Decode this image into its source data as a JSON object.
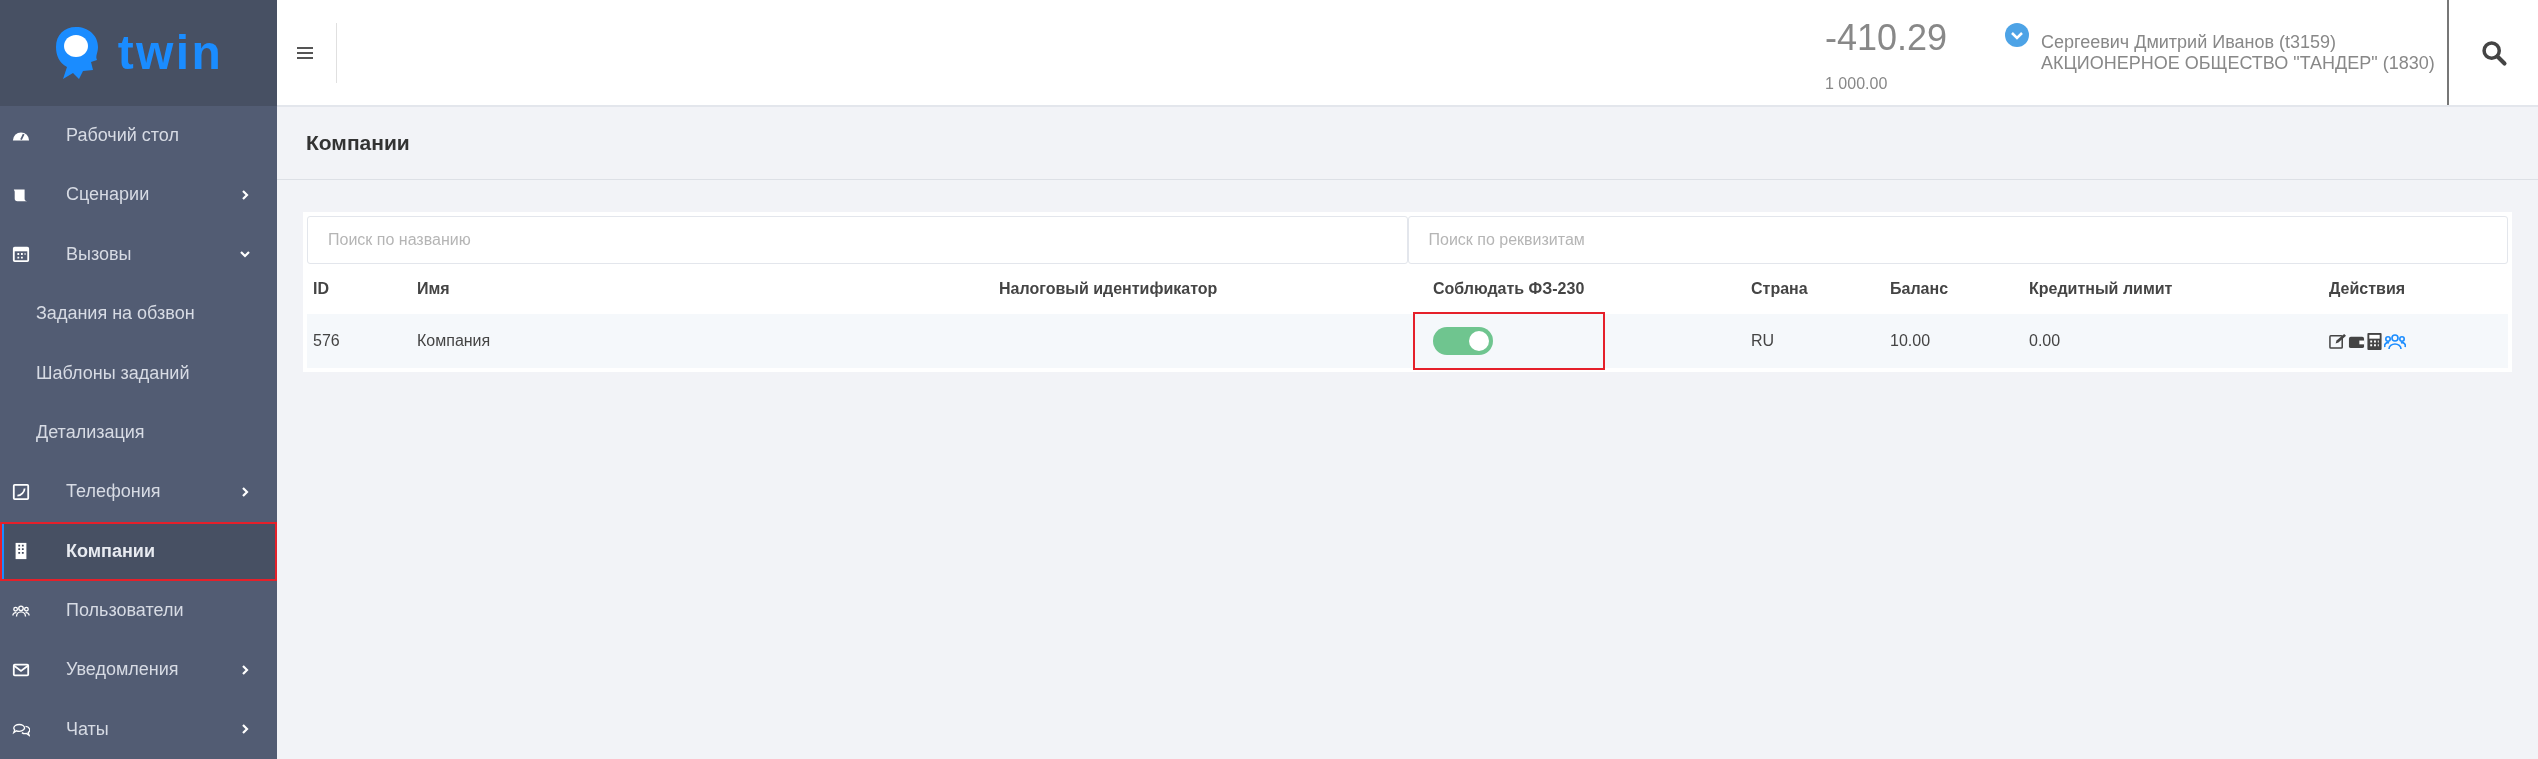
{
  "logo": {
    "text": "twin"
  },
  "topbar": {
    "balance": "-410.29",
    "credit": "1 000.00",
    "user": "Сергеевич Дмитрий Иванов (t3159)",
    "company": "АКЦИОНЕРНОЕ ОБЩЕСТВО \"ТАНДЕР\" (1830)"
  },
  "sidebar": {
    "items": [
      {
        "kind": "item",
        "label": "Рабочий стол",
        "selected": false,
        "highlighted": false
      },
      {
        "kind": "item",
        "label": "Сценарии",
        "selected": false,
        "highlighted": false,
        "expanded": false
      },
      {
        "kind": "item",
        "label": "Вызовы",
        "selected": false,
        "highlighted": false,
        "expanded": true
      },
      {
        "kind": "subitem",
        "label": "Задания на обзвон",
        "selected": false,
        "highlighted": false
      },
      {
        "kind": "subitem",
        "label": "Шаблоны заданий",
        "selected": false,
        "highlighted": false
      },
      {
        "kind": "subitem",
        "label": "Детализация",
        "selected": false,
        "highlighted": false
      },
      {
        "kind": "item",
        "label": "Телефония",
        "selected": false,
        "highlighted": false,
        "expanded": false
      },
      {
        "kind": "item",
        "label": "Компании",
        "selected": true,
        "highlighted": true
      },
      {
        "kind": "item",
        "label": "Пользователи",
        "selected": false,
        "highlighted": false
      },
      {
        "kind": "item",
        "label": "Уведомления",
        "selected": false,
        "highlighted": false,
        "expanded": false
      },
      {
        "kind": "item",
        "label": "Чаты",
        "selected": false,
        "highlighted": false,
        "expanded": false
      }
    ]
  },
  "page": {
    "title": "Компании"
  },
  "filters": [
    {
      "placeholder": "Поиск по названию"
    },
    {
      "placeholder": "Поиск по реквизитам"
    }
  ],
  "table": {
    "columns": [
      "ID",
      "Имя",
      "Налоговый идентификатор",
      "Соблюдать ФЗ-230",
      "Страна",
      "Баланс",
      "Кредитный лимит",
      "Действия"
    ],
    "rows": [
      {
        "id": "576",
        "name": "Компания",
        "fz230": {
          "on": true,
          "highlighted": true
        },
        "country": "RU",
        "balance": "10.00",
        "credit_limit": "0.00"
      }
    ]
  }
}
